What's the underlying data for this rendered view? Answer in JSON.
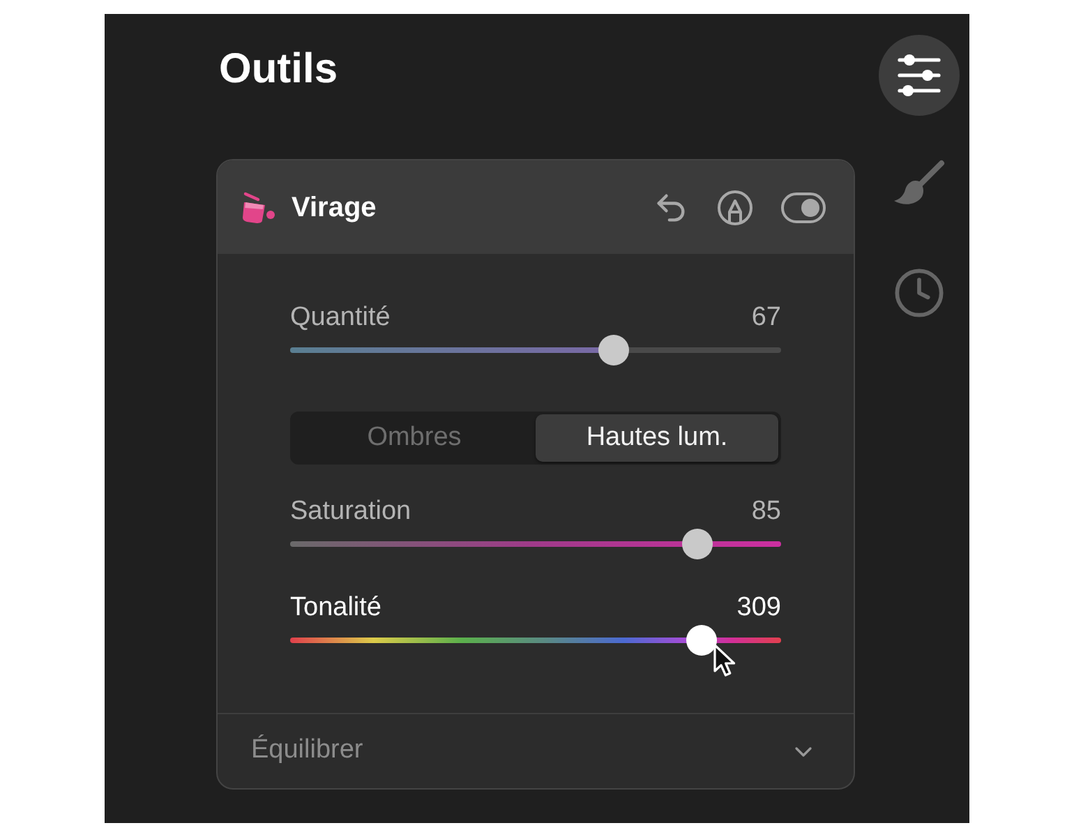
{
  "title": "Outils",
  "sidebar": [
    {
      "kind": "adjust",
      "selected": true
    },
    {
      "kind": "brush",
      "selected": false
    },
    {
      "kind": "history",
      "selected": false
    }
  ],
  "panel": {
    "title": "Virage",
    "enabled": true,
    "amount": {
      "kind": "amount",
      "label": "Quantité",
      "value": "67",
      "level": 0.67,
      "active": false
    },
    "range_tabs": [
      {
        "label": "Ombres",
        "selected": false
      },
      {
        "label": "Hautes lum.",
        "selected": true
      }
    ],
    "sliders": [
      {
        "kind": "saturation",
        "label": "Saturation",
        "value": "85",
        "level": 0.85,
        "active": false
      },
      {
        "kind": "hue",
        "label": "Tonalité",
        "value": "309",
        "level": 0.86,
        "active": true
      }
    ],
    "section": {
      "label": "Équilibrer",
      "expanded": false
    }
  }
}
